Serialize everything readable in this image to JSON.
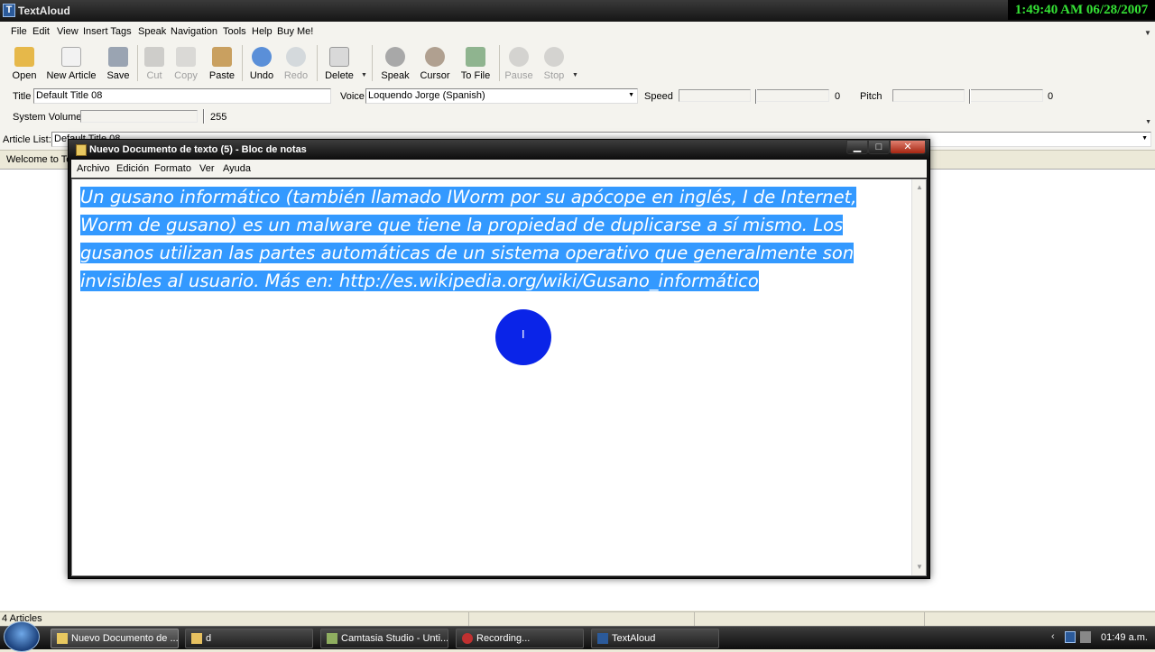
{
  "app": {
    "title": "TextAloud",
    "icon_label": "T",
    "clock": "1:49:40 AM 06/28/2007"
  },
  "menu": [
    "File",
    "Edit",
    "View",
    "Insert Tags",
    "Speak",
    "Navigation",
    "Tools",
    "Help",
    "Buy Me!"
  ],
  "toolbar": {
    "open": "Open",
    "new_article": "New Article",
    "save": "Save",
    "cut": "Cut",
    "copy": "Copy",
    "paste": "Paste",
    "undo": "Undo",
    "redo": "Redo",
    "delete": "Delete",
    "speak": "Speak",
    "cursor": "Cursor",
    "to_file": "To File",
    "pause": "Pause",
    "stop": "Stop"
  },
  "props": {
    "title_label": "Title",
    "title_value": "Default Title 08",
    "voice_label": "Voice",
    "voice_value": "Loquendo Jorge (Spanish)",
    "speed_label": "Speed",
    "speed_value": "0",
    "pitch_label": "Pitch",
    "pitch_value": "0",
    "volume_label": "System Volume",
    "volume_value": "255"
  },
  "article_list": {
    "label": "Article List:",
    "value": "Default Title 08"
  },
  "tab": {
    "label": "Welcome to Te"
  },
  "status": {
    "articles": "4 Articles"
  },
  "notepad": {
    "title": "Nuevo Documento de texto (5) - Bloc de notas",
    "menu": [
      "Archivo",
      "Edición",
      "Formato",
      "Ver",
      "Ayuda"
    ],
    "lines": [
      "Un gusano informático (también llamado IWorm por su apócope en inglés, I de Internet,",
      "Worm de gusano) es un malware que tiene la propiedad de duplicarse a sí mismo. Los",
      "gusanos utilizan las partes automáticas de un sistema operativo que generalmente son",
      "invisibles al usuario. Más en: http://es.wikipedia.org/wiki/Gusano_informático"
    ]
  },
  "taskbar": {
    "items": [
      "Nuevo Documento de ...",
      "d",
      "Camtasia Studio - Unti...",
      "Recording...",
      "TextAloud"
    ],
    "time": "01:49 a.m."
  },
  "colors": {
    "selection": "#3399ff",
    "clock_text": "#35e235",
    "cursor_highlight": "#0a24e8"
  }
}
